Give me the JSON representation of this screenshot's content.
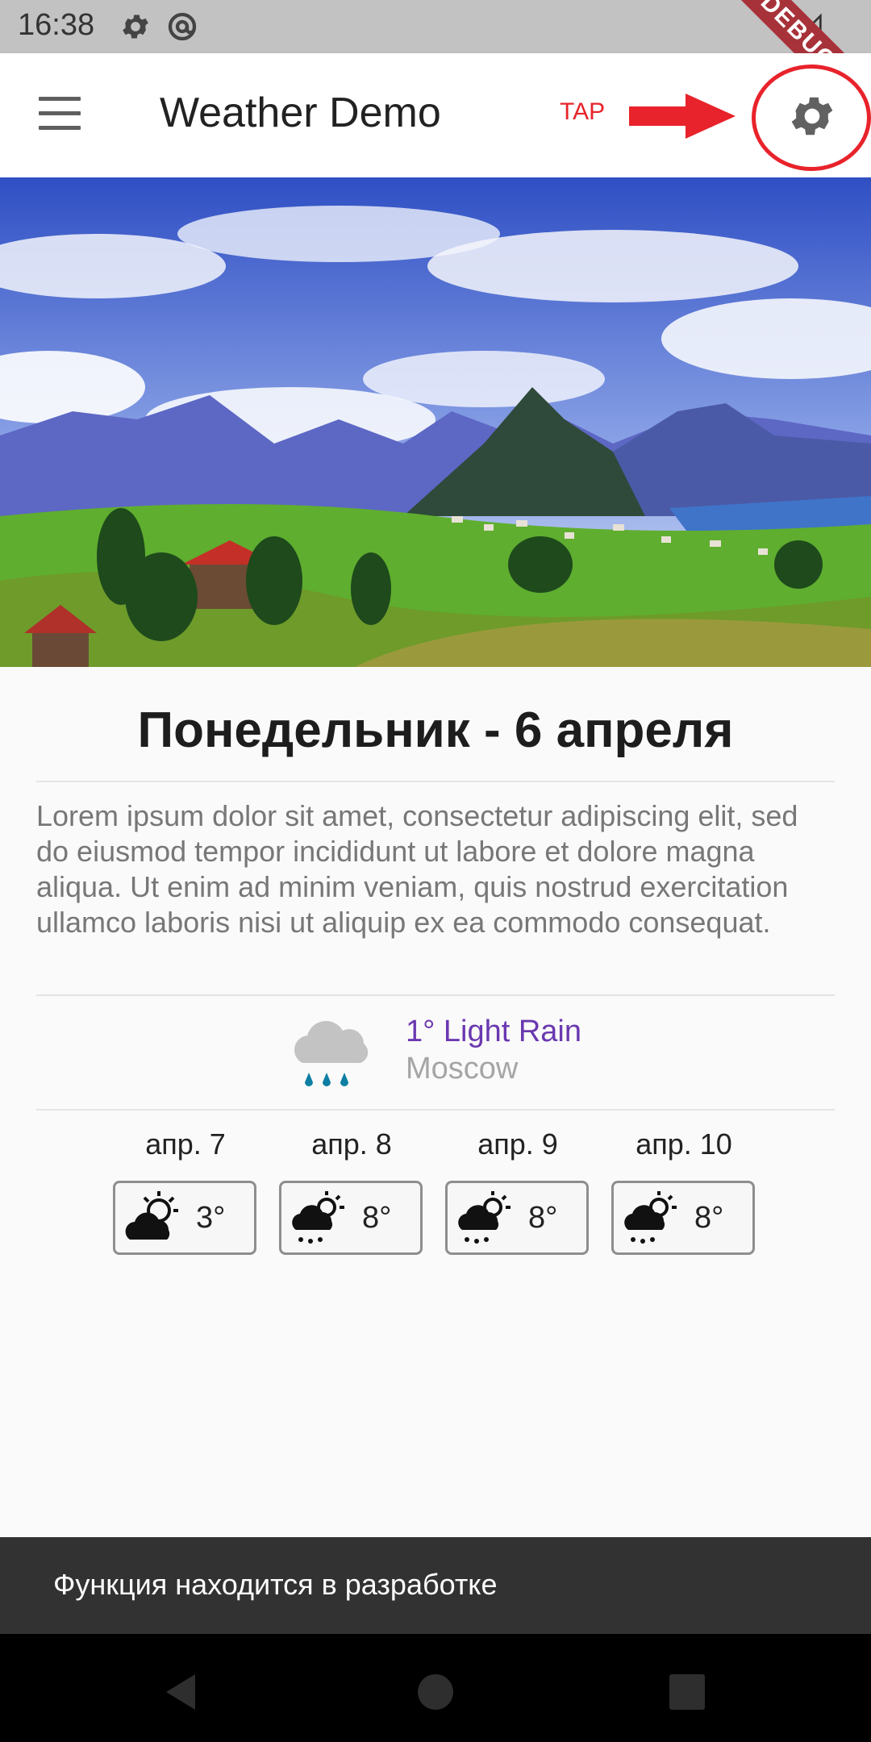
{
  "status_bar": {
    "time": "16:38",
    "debug_banner": "DEBUG",
    "icons": [
      "settings-icon",
      "at-icon",
      "wifi-icon",
      "signal-icon"
    ]
  },
  "app_bar": {
    "title": "Weather Demo",
    "menu_icon": "menu-icon",
    "settings_icon": "gear-icon",
    "annotation_label": "TAP",
    "annotation_color": "#e8232b"
  },
  "hero": {
    "image": "alpine-landscape"
  },
  "content": {
    "date_title": "Понедельник - 6 апреля",
    "description": "Lorem ipsum dolor sit amet, consectetur adipiscing elit, sed do eiusmod tempor incididunt ut labore et dolore magna aliqua. Ut enim ad minim veniam, quis nostrud exercitation ullamco laboris nisi ut aliquip ex ea commodo consequat.",
    "current_weather": {
      "icon": "rain-cloud-icon",
      "summary": "1° Light Rain",
      "city": "Moscow",
      "summary_color": "#6a38b0"
    },
    "forecast": [
      {
        "date": "апр. 7",
        "temp": "3°",
        "icon": "sun-cloud-icon"
      },
      {
        "date": "апр. 8",
        "temp": "8°",
        "icon": "sun-cloud-rain-icon"
      },
      {
        "date": "апр. 9",
        "temp": "8°",
        "icon": "sun-cloud-rain-icon"
      },
      {
        "date": "апр. 10",
        "temp": "8°",
        "icon": "sun-cloud-rain-icon"
      }
    ]
  },
  "snackbar": {
    "message": "Функция находится в разработке"
  },
  "nav_bar": {
    "buttons": [
      "back-icon",
      "home-icon",
      "recents-icon"
    ]
  }
}
